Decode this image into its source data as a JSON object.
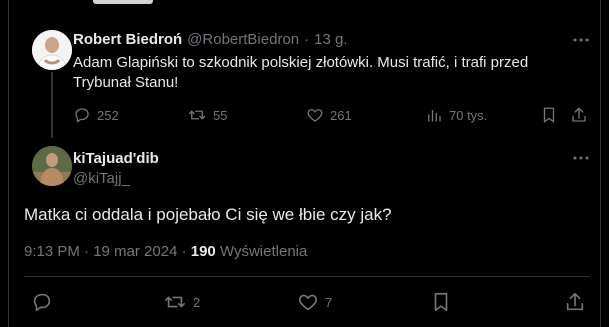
{
  "quoted_tweet": {
    "author_name": "Robert Biedroń",
    "author_handle": "@RobertBiedron",
    "separator": "·",
    "time": "13 g.",
    "text_line1": "Adam Glapiński to szkodnik polskiej złotówki. Musi trafić, i trafi przed",
    "text_line2": "Trybunał Stanu!",
    "replies": "252",
    "retweets": "55",
    "likes": "261",
    "views": "70 tys."
  },
  "reply_tweet": {
    "author_name": "kiTajuad'dib",
    "author_handle": "@kiTajj_",
    "text": "Matka ci oddala i pojebało Ci się we łbie czy jak?",
    "time_date": "9:13 PM · 19 mar 2024 ·",
    "views_count": "190",
    "views_label": "Wyświetlenia",
    "replies": "",
    "retweets": "2",
    "likes": "7"
  },
  "icons": {
    "reply": "reply-icon",
    "retweet": "retweet-icon",
    "like": "heart-icon",
    "views": "views-chart-icon",
    "bookmark": "bookmark-icon",
    "share": "share-icon",
    "more": "more-icon"
  },
  "colors": {
    "background": "#000000",
    "text_primary": "#e7e9ea",
    "text_secondary": "#71767b",
    "divider": "#2f3336"
  }
}
